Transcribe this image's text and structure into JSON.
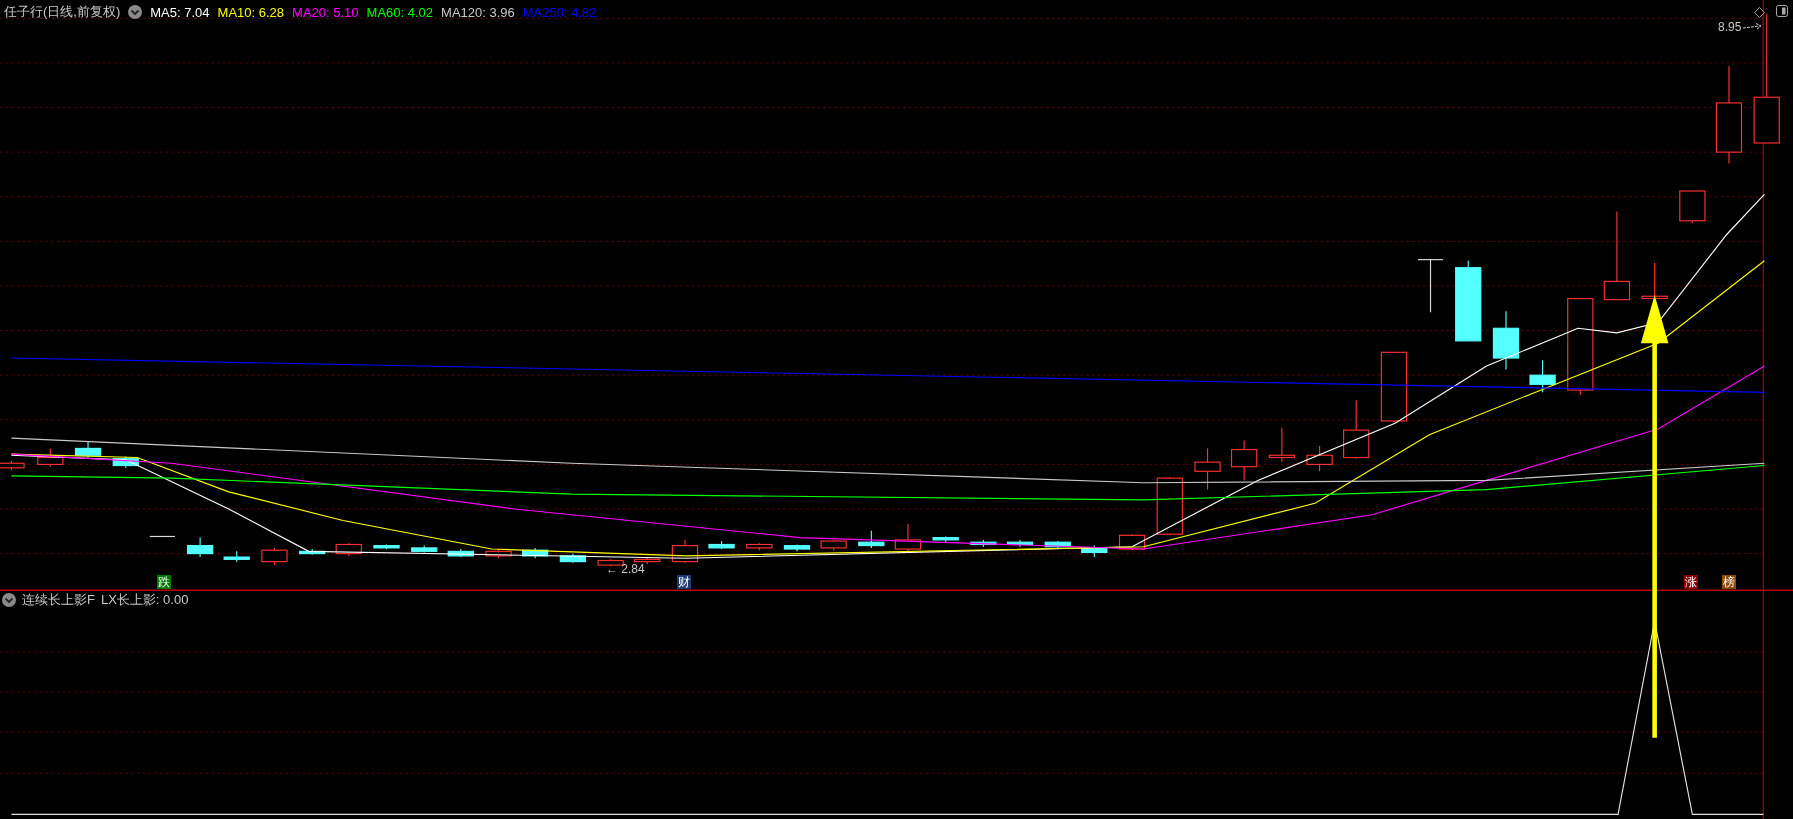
{
  "chart": {
    "title": "任子行(日线,前复权)",
    "ma": [
      {
        "label": "MA5: 7.04",
        "color": "#ffffff"
      },
      {
        "label": "MA10: 6.28",
        "color": "#ffff00"
      },
      {
        "label": "MA20: 5.10",
        "color": "#ff00ff"
      },
      {
        "label": "MA60: 4.02",
        "color": "#00ff00"
      },
      {
        "label": "MA120: 3.96",
        "color": "#c8c8c8"
      },
      {
        "label": "MA250: 4.82",
        "color": "#0000ff"
      }
    ],
    "price_labels": [
      {
        "text": "8.95",
        "kind": "high"
      },
      {
        "text": "← 2.84",
        "kind": "low"
      }
    ],
    "markers": [
      {
        "text": "跌",
        "color": "#007a00"
      },
      {
        "text": "财",
        "color": "#1c3a6e"
      },
      {
        "text": "涨",
        "color": "#8b0000"
      },
      {
        "text": "榜",
        "color": "#8b4a0a"
      }
    ]
  },
  "indicator": {
    "name": "连续长上影F",
    "reading": "LX长上影: 0.00"
  }
}
